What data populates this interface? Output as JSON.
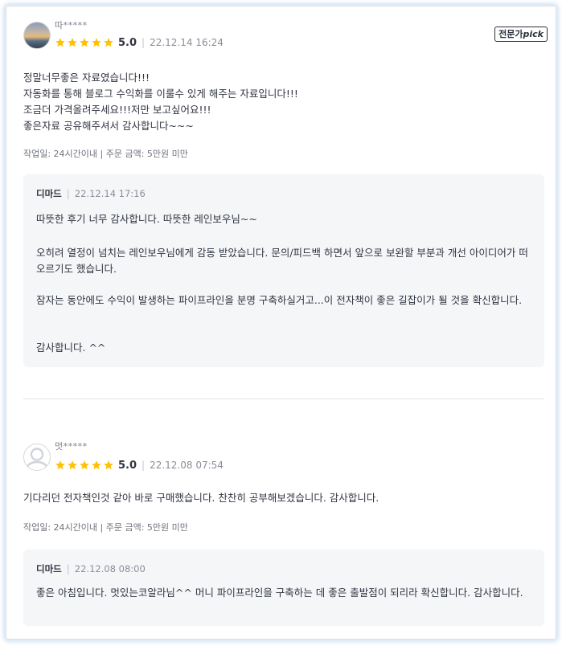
{
  "reviews": [
    {
      "nickname": "따*****",
      "avatar": "profile-photo",
      "score": "5.0",
      "date": "22.12.14 16:24",
      "badge": {
        "prefix": "전문가",
        "pick": "pick"
      },
      "body": [
        "정말너무좋은 자료였습니다!!!",
        "자동화를 통해 블로그 수익화를 이룰수 있게 해주는 자료입니다!!!",
        "조금더 가격올려주세요!!!저만 보고싶어요!!!",
        "좋은자료 공유해주셔서 감사합니다~~~"
      ],
      "meta": "작업일: 24시간이내 | 주문 금액: 5만원 미만",
      "reply": {
        "seller": "디마드",
        "date": "22.12.14 17:16",
        "paragraphs": [
          "따뜻한 후기 너무 감사합니다. 따뜻한 레인보우님~~",
          "오히려 열정이 넘치는 레인보우님에게 감동 받았습니다. 문의/피드백 하면서 앞으로 보완할 부분과 개선 아이디어가 떠오르기도 했습니다.",
          "잠자는 동안에도 수익이 발생하는 파이프라인을 분명 구축하실거고...이 전자책이 좋은 길잡이가 될 것을 확신합니다.",
          "감사합니다. ^^"
        ]
      }
    },
    {
      "nickname": "멋*****",
      "avatar": "default-user-icon",
      "score": "5.0",
      "date": "22.12.08 07:54",
      "body": [
        "기다리던 전자책인것 같아 바로 구매했습니다. 찬찬히 공부해보겠습니다. 감사합니다."
      ],
      "meta": "작업일: 24시간이내 | 주문 금액: 5만원 미만",
      "reply": {
        "seller": "디마드",
        "date": "22.12.08 08:00",
        "paragraphs": [
          "좋은 아침입니다.  멋있는코알라님^^\n머니 파이프라인을 구축하는 데 좋은 출발점이 되리라 확신합니다.  감사합니다."
        ]
      }
    }
  ],
  "colors": {
    "star": "#ffc107",
    "text": "#303441",
    "muted": "#8a8e99",
    "reply_bg": "#f5f6f8"
  },
  "icons": {
    "rating": "star-icon",
    "avatar_default": "user-icon"
  }
}
